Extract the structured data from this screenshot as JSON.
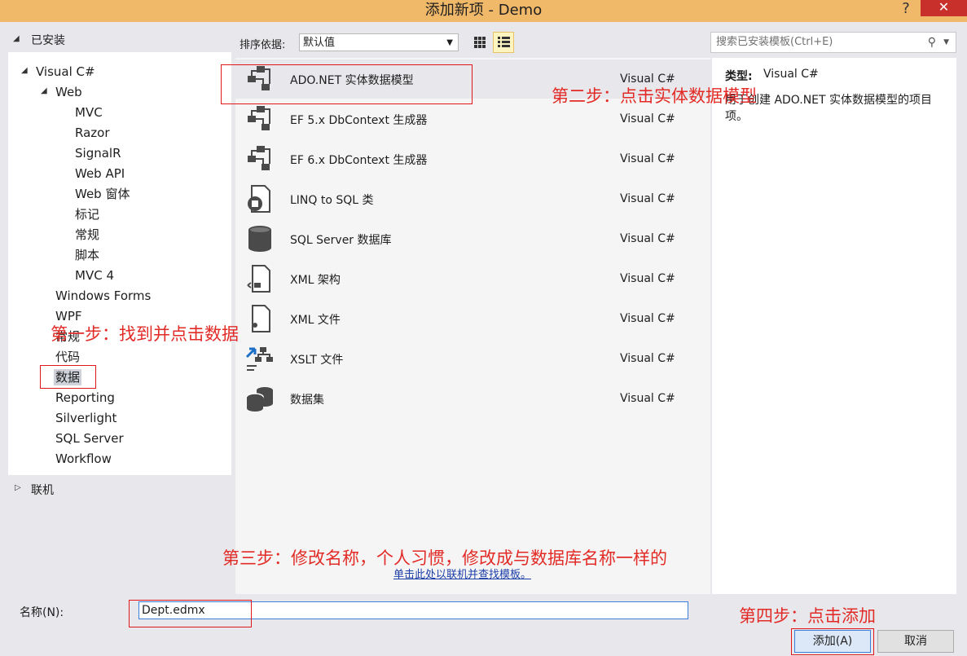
{
  "window": {
    "title": "添加新项 - Demo",
    "help_label": "?",
    "close_label": "✕"
  },
  "sidebar": {
    "installed_label": "已安装",
    "tree": {
      "visual_csharp": "Visual C#",
      "web": "Web",
      "web_children": [
        "MVC",
        "Razor",
        "SignalR",
        "Web API",
        "Web 窗体",
        "标记",
        "常规",
        "脚本",
        "MVC 4"
      ],
      "windows_forms": "Windows Forms",
      "wpf": "WPF",
      "general": "常规",
      "code": "代码",
      "data": "数据",
      "reporting": "Reporting",
      "silverlight": "Silverlight",
      "sql_server": "SQL Server",
      "workflow": "Workflow"
    },
    "online_label": "联机"
  },
  "toolbar": {
    "sort_label": "排序依据:",
    "sort_value": "默认值",
    "search_placeholder": "搜索已安装模板(Ctrl+E)"
  },
  "templates": [
    {
      "name": "ADO.NET 实体数据模型",
      "lang": "Visual C#",
      "icon": "entity-model-icon"
    },
    {
      "name": "EF 5.x DbContext 生成器",
      "lang": "Visual C#",
      "icon": "entity-model-icon"
    },
    {
      "name": "EF 6.x DbContext 生成器",
      "lang": "Visual C#",
      "icon": "entity-model-icon"
    },
    {
      "name": "LINQ to SQL 类",
      "lang": "Visual C#",
      "icon": "linq-icon"
    },
    {
      "name": "SQL Server 数据库",
      "lang": "Visual C#",
      "icon": "database-icon"
    },
    {
      "name": "XML 架构",
      "lang": "Visual C#",
      "icon": "xml-schema-icon"
    },
    {
      "name": "XML 文件",
      "lang": "Visual C#",
      "icon": "xml-file-icon"
    },
    {
      "name": "XSLT 文件",
      "lang": "Visual C#",
      "icon": "xslt-icon"
    },
    {
      "name": "数据集",
      "lang": "Visual C#",
      "icon": "dataset-icon"
    }
  ],
  "online_link": "单击此处以联机并查找模板。",
  "details": {
    "type_label": "类型:",
    "type_value": "Visual C#",
    "description": "用于创建 ADO.NET 实体数据模型的项目项。"
  },
  "footer": {
    "name_label": "名称(N):",
    "name_value": "Dept.edmx",
    "add_label": "添加(A)",
    "cancel_label": "取消"
  },
  "annotations": {
    "step1": "第一步：找到并点击数据",
    "step2": "第二步：点击实体数据模型",
    "step3": "第三步：修改名称，个人习惯，修改成与数据库名称一样的",
    "step4": "第四步：点击添加"
  },
  "colors": {
    "titlebar": "#f0b96a",
    "close_button": "#c7302b",
    "annotation_red": "#e22b26",
    "link_blue": "#1c3ea8"
  }
}
